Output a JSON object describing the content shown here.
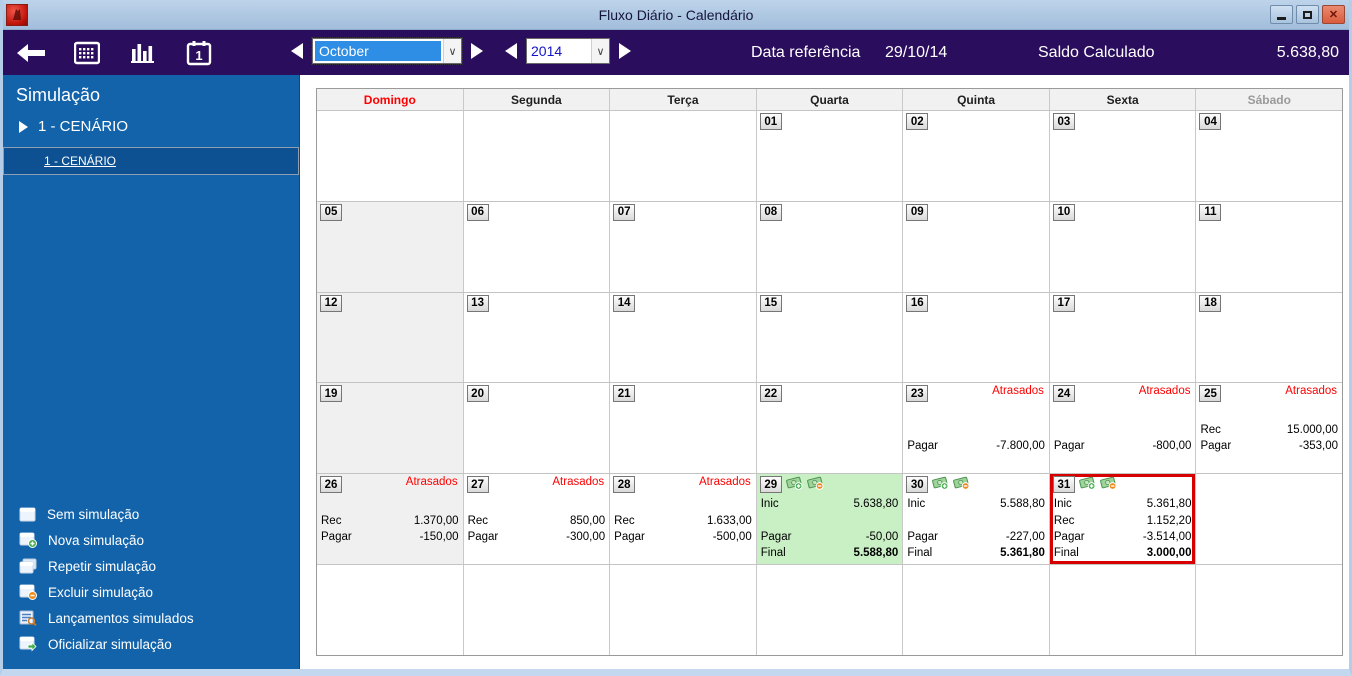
{
  "window": {
    "title": "Fluxo Diário - Calendário"
  },
  "toolbar": {
    "month_value": "October",
    "year_value": "2014",
    "data_referencia_label": "Data referência",
    "data_referencia_value": "29/10/14",
    "saldo_label": "Saldo Calculado",
    "saldo_value": "5.638,80"
  },
  "sidebar": {
    "title": "Simulação",
    "tree_parent": "1 - CENÁRIO",
    "tree_child": "1 - CENÁRIO",
    "actions": [
      {
        "label": "Sem simulação",
        "icon": "window-icon"
      },
      {
        "label": "Nova simulação",
        "icon": "window-add-icon"
      },
      {
        "label": "Repetir simulação",
        "icon": "windows-copy-icon"
      },
      {
        "label": "Excluir simulação",
        "icon": "window-remove-icon"
      },
      {
        "label": "Lançamentos simulados",
        "icon": "list-search-icon"
      },
      {
        "label": "Oficializar simulação",
        "icon": "window-export-icon"
      }
    ]
  },
  "calendar": {
    "weekday_headers": [
      {
        "label": "Domingo",
        "style": "sunday"
      },
      {
        "label": "Segunda",
        "style": ""
      },
      {
        "label": "Terça",
        "style": ""
      },
      {
        "label": "Quarta",
        "style": ""
      },
      {
        "label": "Quinta",
        "style": ""
      },
      {
        "label": "Sexta",
        "style": ""
      },
      {
        "label": "Sábado",
        "style": "saturday"
      }
    ],
    "overdue_label": "Atrasados",
    "line_labels": {
      "inic": "Inic",
      "rec": "Rec",
      "pagar": "Pagar",
      "final": "Final"
    },
    "accent_colors": {
      "overdue_red": "#ff0000",
      "selection_red": "#d60000",
      "highlight_green": "#c9efc5"
    },
    "weeks": [
      {
        "cells": [
          {},
          {},
          {},
          {
            "day": "01"
          },
          {
            "day": "02"
          },
          {
            "day": "03"
          },
          {
            "day": "04"
          }
        ]
      },
      {
        "cells": [
          {
            "day": "05",
            "sunday": true
          },
          {
            "day": "06"
          },
          {
            "day": "07"
          },
          {
            "day": "08"
          },
          {
            "day": "09"
          },
          {
            "day": "10"
          },
          {
            "day": "11"
          }
        ]
      },
      {
        "cells": [
          {
            "day": "12",
            "sunday": true
          },
          {
            "day": "13"
          },
          {
            "day": "14"
          },
          {
            "day": "15"
          },
          {
            "day": "16"
          },
          {
            "day": "17"
          },
          {
            "day": "18"
          }
        ]
      },
      {
        "cells": [
          {
            "day": "19",
            "sunday": true
          },
          {
            "day": "20"
          },
          {
            "day": "21"
          },
          {
            "day": "22"
          },
          {
            "day": "23",
            "atrasados": true,
            "lines": {
              "pagar": "-7.800,00"
            }
          },
          {
            "day": "24",
            "atrasados": true,
            "lines": {
              "pagar": "-800,00"
            }
          },
          {
            "day": "25",
            "atrasados": true,
            "lines": {
              "rec": "15.000,00",
              "pagar": "-353,00"
            }
          }
        ]
      },
      {
        "cells": [
          {
            "day": "26",
            "sunday": true,
            "atrasados": true,
            "lines": {
              "rec": "1.370,00",
              "pagar": "-150,00"
            }
          },
          {
            "day": "27",
            "atrasados": true,
            "lines": {
              "rec": "850,00",
              "pagar": "-300,00"
            }
          },
          {
            "day": "28",
            "atrasados": true,
            "lines": {
              "rec": "1.633,00",
              "pagar": "-500,00"
            }
          },
          {
            "day": "29",
            "highlight": "green",
            "money_icons": true,
            "lines": {
              "inic": "5.638,80",
              "pagar": "-50,00",
              "final": "5.588,80"
            }
          },
          {
            "day": "30",
            "money_icons": true,
            "lines": {
              "inic": "5.588,80",
              "pagar": "-227,00",
              "final": "5.361,80"
            }
          },
          {
            "day": "31",
            "selected_red": true,
            "money_icons": true,
            "lines": {
              "inic": "5.361,80",
              "rec": "1.152,20",
              "pagar": "-3.514,00",
              "final": "3.000,00"
            }
          },
          {}
        ]
      },
      {
        "cells": [
          {},
          {},
          {},
          {},
          {},
          {},
          {}
        ]
      }
    ]
  }
}
